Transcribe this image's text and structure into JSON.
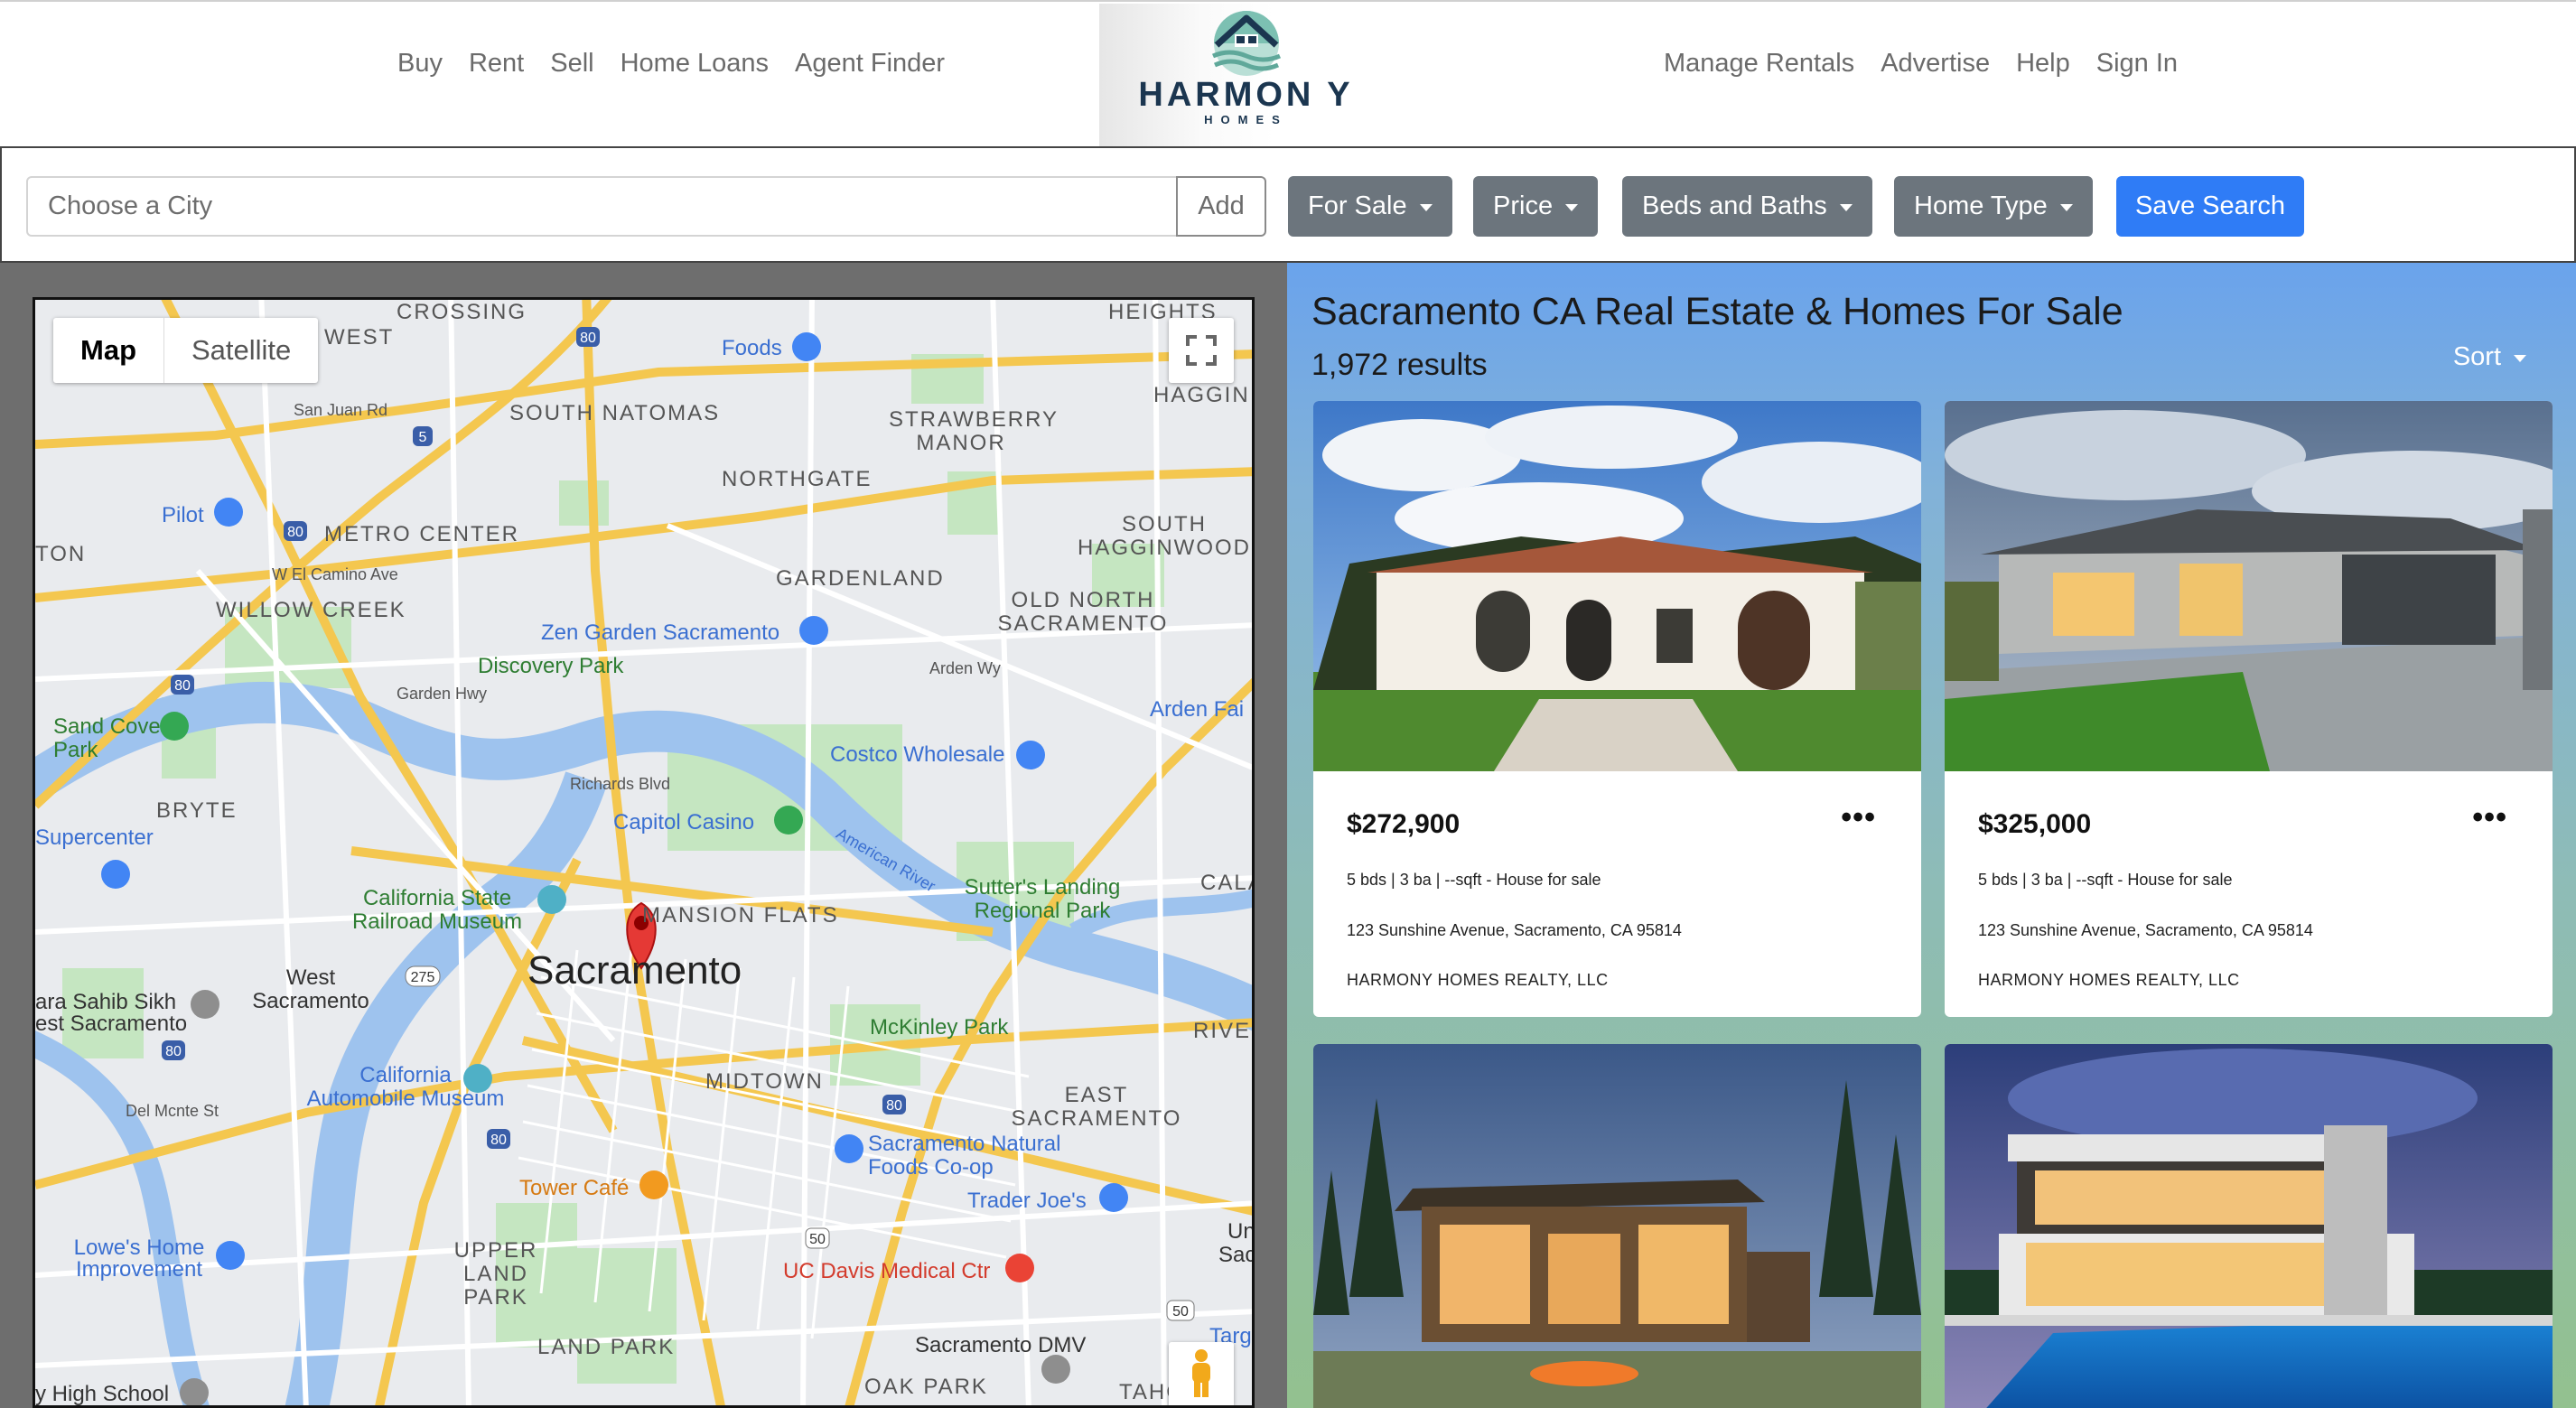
{
  "header": {
    "nav_left": [
      "Buy",
      "Rent",
      "Sell",
      "Home Loans",
      "Agent Finder"
    ],
    "nav_right": [
      "Manage Rentals",
      "Advertise",
      "Help",
      "Sign In"
    ],
    "logo": {
      "name": "HARMON Y",
      "tagline": "HOMES"
    }
  },
  "filters": {
    "city_placeholder": "Choose a City",
    "add_label": "Add",
    "dropdowns": [
      "For Sale",
      "Price",
      "Beds and Baths",
      "Home Type"
    ],
    "save_label": "Save Search"
  },
  "map": {
    "toggle": [
      "Map",
      "Satellite"
    ],
    "city_label": "Sacramento",
    "labels": {
      "crossing": "CROSSING",
      "west": "WEST",
      "heights": "HEIGHTS",
      "haggin": "HAGGIN",
      "foods": "Foods",
      "san_juan_rd": "San Juan Rd",
      "south_natomas": "SOUTH NATOMAS",
      "san_juan_rd2": "San Juan Rd",
      "strawberry_manor": "STRAWBERRY MANOR",
      "northgate": "NORTHGATE",
      "south_hagginwood": "SOUTH HAGGINWOOD",
      "pilot": "Pilot",
      "metro_center": "METRO CENTER",
      "ton": "TON",
      "w_el_camino": "W El Camino Ave",
      "gardenland": "GARDENLAND",
      "old_north_sac": "OLD NORTH SACRAMENTO",
      "willow_creek": "WILLOW CREEK",
      "zen_garden": "Zen Garden Sacramento",
      "discovery_park": "Discovery Park",
      "arden_wy": "Arden Wy",
      "garden_hwy": "Garden Hwy",
      "arden_fair": "Arden Fai",
      "sand_cove_park": "Sand Cove Park",
      "costco": "Costco Wholesale",
      "richards_blvd": "Richards Blvd",
      "bryte": "BRYTE",
      "capitol_casino": "Capitol Casino",
      "american_river": "American River",
      "supercenter": "Supercenter",
      "sutters_landing": "Sutter's Landing Regional Park",
      "ca_state_railroad": "California State Railroad Museum",
      "mansion_flats": "MANSION FLATS",
      "west_sacramento": "West Sacramento",
      "cala": "CALA",
      "sahib": "ara Sahib Sikh",
      "est_sac": "est Sacramento",
      "mckinley_park": "McKinley Park",
      "rive": "RIVE",
      "midtown": "MIDTOWN",
      "ca_auto_museum": "California Automobile Museum",
      "del_monte": "Del Mcnte St",
      "east_sacramento": "EAST SACRAMENTO",
      "sac_natural_foods": "Sacramento Natural Foods Co-op",
      "tower_cafe": "Tower Café",
      "trader_joes": "Trader Joe's",
      "lowes": "Lowe's Home Improvement",
      "upper_land_park": "UPPER LAND PARK",
      "uc_davis": "UC Davis Medical Ctr",
      "land_park": "LAND PARK",
      "sac_dmv": "Sacramento DMV",
      "oak_park": "OAK PARK",
      "high_school": "y High School",
      "tahc": "TAHC",
      "targ": "Targ",
      "un": "Un",
      "sac2": "Sac"
    },
    "shields": [
      "80",
      "5",
      "80",
      "80",
      "275",
      "80",
      "80",
      "50",
      "50",
      "80"
    ]
  },
  "listings": {
    "title": "Sacramento CA Real Estate & Homes For Sale",
    "count": "1,972 results",
    "sort_label": "Sort",
    "more_icon": "•••",
    "cards": [
      {
        "price": "$272,900",
        "facts": "5 bds | 3 ba | --sqft - House for sale",
        "address": "123 Sunshine Avenue, Sacramento, CA 95814",
        "broker": "HARMONY HOMES REALTY, LLC"
      },
      {
        "price": "$325,000",
        "facts": "5 bds | 3 ba | --sqft - House for sale",
        "address": "123 Sunshine Avenue, Sacramento, CA 95814",
        "broker": "HARMONY HOMES REALTY, LLC"
      },
      {
        "price": "",
        "facts": "",
        "address": "",
        "broker": ""
      },
      {
        "price": "",
        "facts": "",
        "address": "",
        "broker": ""
      }
    ]
  },
  "colors": {
    "accent": "#2f7cf6",
    "dropdown": "#6c757d",
    "logo_navy": "#1b3650",
    "logo_teal": "#5fa89a"
  }
}
